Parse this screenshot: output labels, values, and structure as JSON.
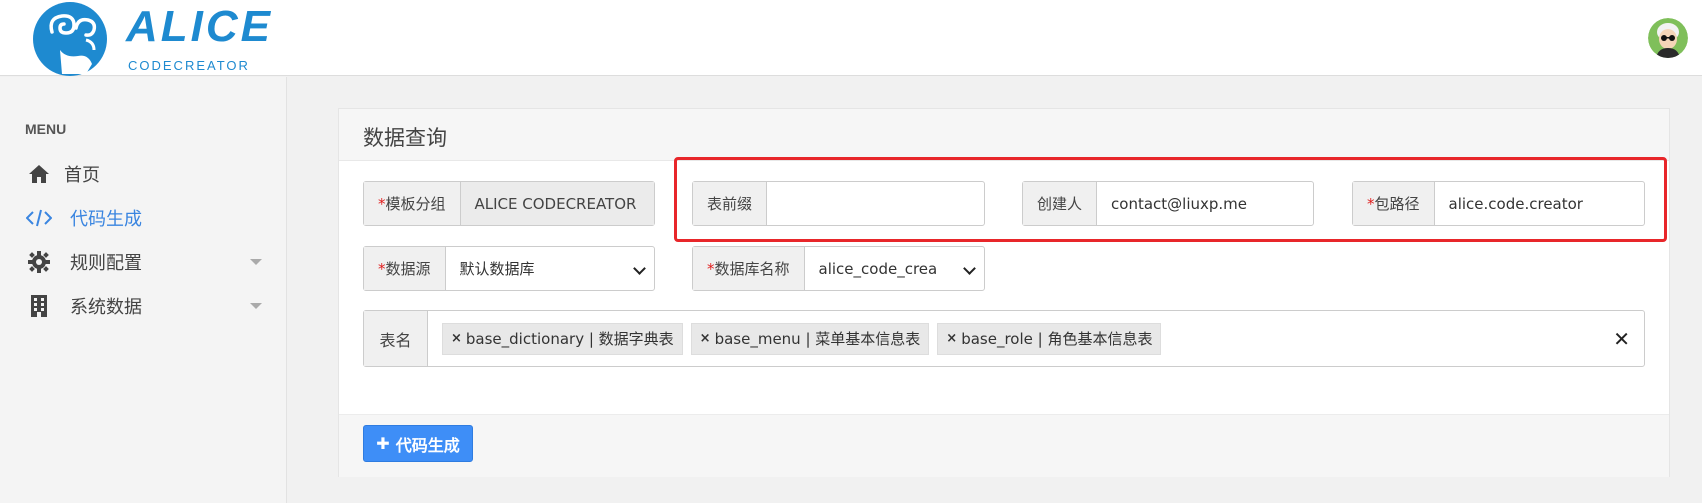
{
  "brand": {
    "title": "ALICE",
    "subtitle": "CODECREATOR",
    "color": "#1e8ad0"
  },
  "sidebar": {
    "heading": "MENU",
    "items": [
      {
        "label": "首页",
        "icon": "home-icon"
      },
      {
        "label": "代码生成",
        "icon": "code-icon",
        "active": true
      },
      {
        "label": "规则配置",
        "icon": "gear-icon"
      },
      {
        "label": "系统数据",
        "icon": "building-icon"
      }
    ]
  },
  "panel": {
    "title": "数据查询",
    "template_group": {
      "label": "模板分组",
      "value": "ALICE CODECREATOR"
    },
    "table_prefix": {
      "label": "表前缀",
      "value": ""
    },
    "creator": {
      "label": "创建人",
      "value": "contact@liuxp.me"
    },
    "package_path": {
      "label": "包路径",
      "value": "alice.code.creator"
    },
    "datasource": {
      "label": "数据源",
      "value": "默认数据库"
    },
    "db_name": {
      "label": "数据库名称",
      "value": "alice_code_crea"
    },
    "tables": {
      "label": "表名",
      "tags": [
        "base_dictionary | 数据字典表",
        "base_menu | 菜单基本信息表",
        "base_role | 角色基本信息表"
      ]
    },
    "generate_button": "代码生成"
  },
  "colors": {
    "accent": "#3e8ef7",
    "active_nav": "#3a85e0",
    "required": "#e02020",
    "highlight": "#e8262a"
  }
}
